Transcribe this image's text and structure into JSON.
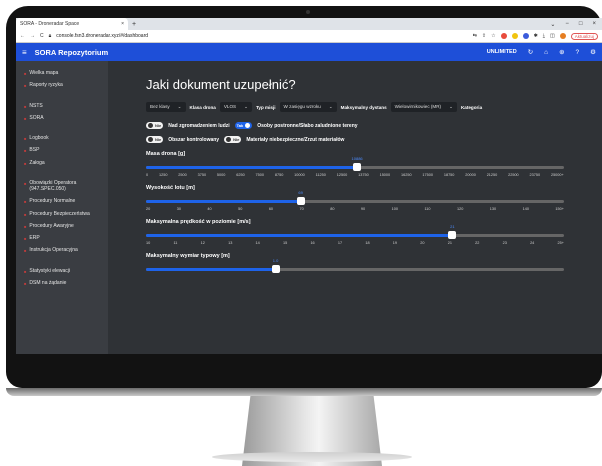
{
  "browser": {
    "tab_title": "SORA - Droneradar Space",
    "url": "console.fsn3.droneradar.xyz/#/dashboard",
    "update_label": "Aktualizuj"
  },
  "app": {
    "title": "SORA Repozytorium",
    "unlimited": "UNLIMITED"
  },
  "sidebar": {
    "items": [
      "Wielka mapa",
      "Raporty ryzyka",
      "NSTS",
      "SORA",
      "Logbook",
      "BSP",
      "Załoga",
      "Obowiązki Operatora (947.SPEC.050)",
      "Procedury Normalne",
      "Procedury Bezpieczeństwa",
      "Procedury Awaryjne",
      "ERP",
      "Instrukcja Operacyjna",
      "Statystyki elewacji",
      "DSM na żądanie"
    ]
  },
  "main": {
    "heading": "Jaki dokument uzupełnić?",
    "filters": {
      "klasa_value": "Bez klasy",
      "klasa_drona_label": "Klasa drona",
      "klasa_drona_value": "VLOS",
      "typ_misji_label": "Typ misji",
      "typ_misji_value": "W zasięgu wzroku",
      "dystans_label": "Maksymalny dystans",
      "dystans_value": "Wielowirnikowiec (MR)",
      "kategoria_label": "Kategoria"
    },
    "toggles_row1": {
      "t1_state": "Nie",
      "t1_label": "Nad zgromadzeniem ludzi",
      "t2_state": "Tak",
      "t2_label": "Osoby postronne/Słabo zaludnione tereny"
    },
    "toggles_row2": {
      "t1_state": "Nie",
      "t1_label": "Obszar kontrolowany",
      "t2_state": "Nie",
      "t2_label": "Materiały niebezpieczne/Zrzut materiałów"
    },
    "sliders": [
      {
        "title": "Masa drona [g]",
        "value_label": "10886",
        "fraction": 0.505,
        "ticks": [
          "0",
          "1250",
          "2500",
          "3750",
          "5000",
          "6250",
          "7500",
          "8750",
          "10000",
          "11250",
          "12500",
          "13750",
          "15000",
          "16250",
          "17500",
          "18750",
          "20000",
          "21250",
          "22500",
          "23750",
          "25000+"
        ]
      },
      {
        "title": "Wysokość lotu [m]",
        "value_label": "69",
        "fraction": 0.37,
        "ticks": [
          "20",
          "30",
          "40",
          "50",
          "60",
          "70",
          "80",
          "90",
          "100",
          "110",
          "120",
          "130",
          "140",
          "150+"
        ]
      },
      {
        "title": "Maksymalna prędkość w poziomie [m/s]",
        "value_label": "21",
        "fraction": 0.733,
        "ticks": [
          "10",
          "11",
          "12",
          "13",
          "14",
          "15",
          "16",
          "17",
          "18",
          "19",
          "20",
          "21",
          "22",
          "23",
          "24",
          "25+"
        ]
      },
      {
        "title": "Maksymalny wymiar typowy [m]",
        "value_label": "1.0",
        "fraction": 0.31,
        "ticks": []
      }
    ]
  },
  "colors": {
    "accent": "#1e4fd8",
    "slider": "#1e63e9",
    "background": "#2f3236",
    "sidebar": "#3a3d42"
  }
}
